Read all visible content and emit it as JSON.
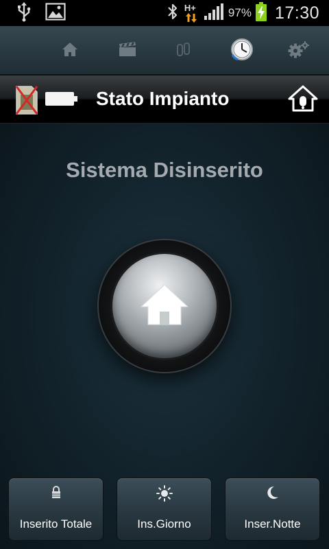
{
  "status_bar": {
    "network_type": "H+",
    "battery_percent": "97%",
    "time": "17:30"
  },
  "tabs": [
    {
      "name": "home",
      "icon": "home-icon",
      "selected": false
    },
    {
      "name": "video",
      "icon": "clapperboard-icon",
      "selected": false
    },
    {
      "name": "zones",
      "icon": "sensor-icon",
      "selected": false
    },
    {
      "name": "history",
      "icon": "clock-icon",
      "selected": true
    },
    {
      "name": "settings",
      "icon": "gears-icon",
      "selected": false
    }
  ],
  "header": {
    "title": "Stato Impianto"
  },
  "main": {
    "state_text": "Sistema Disinserito",
    "big_button_icon": "home-icon"
  },
  "modes": [
    {
      "label": "Inserito Totale",
      "icon": "lock-icon"
    },
    {
      "label": "Ins.Giorno",
      "icon": "sun-icon"
    },
    {
      "label": "Inser.Notte",
      "icon": "moon-icon"
    }
  ],
  "colors": {
    "accent_battery": "#8ed11c",
    "state_text": "#a4aaad",
    "warning_red": "#d22828"
  }
}
